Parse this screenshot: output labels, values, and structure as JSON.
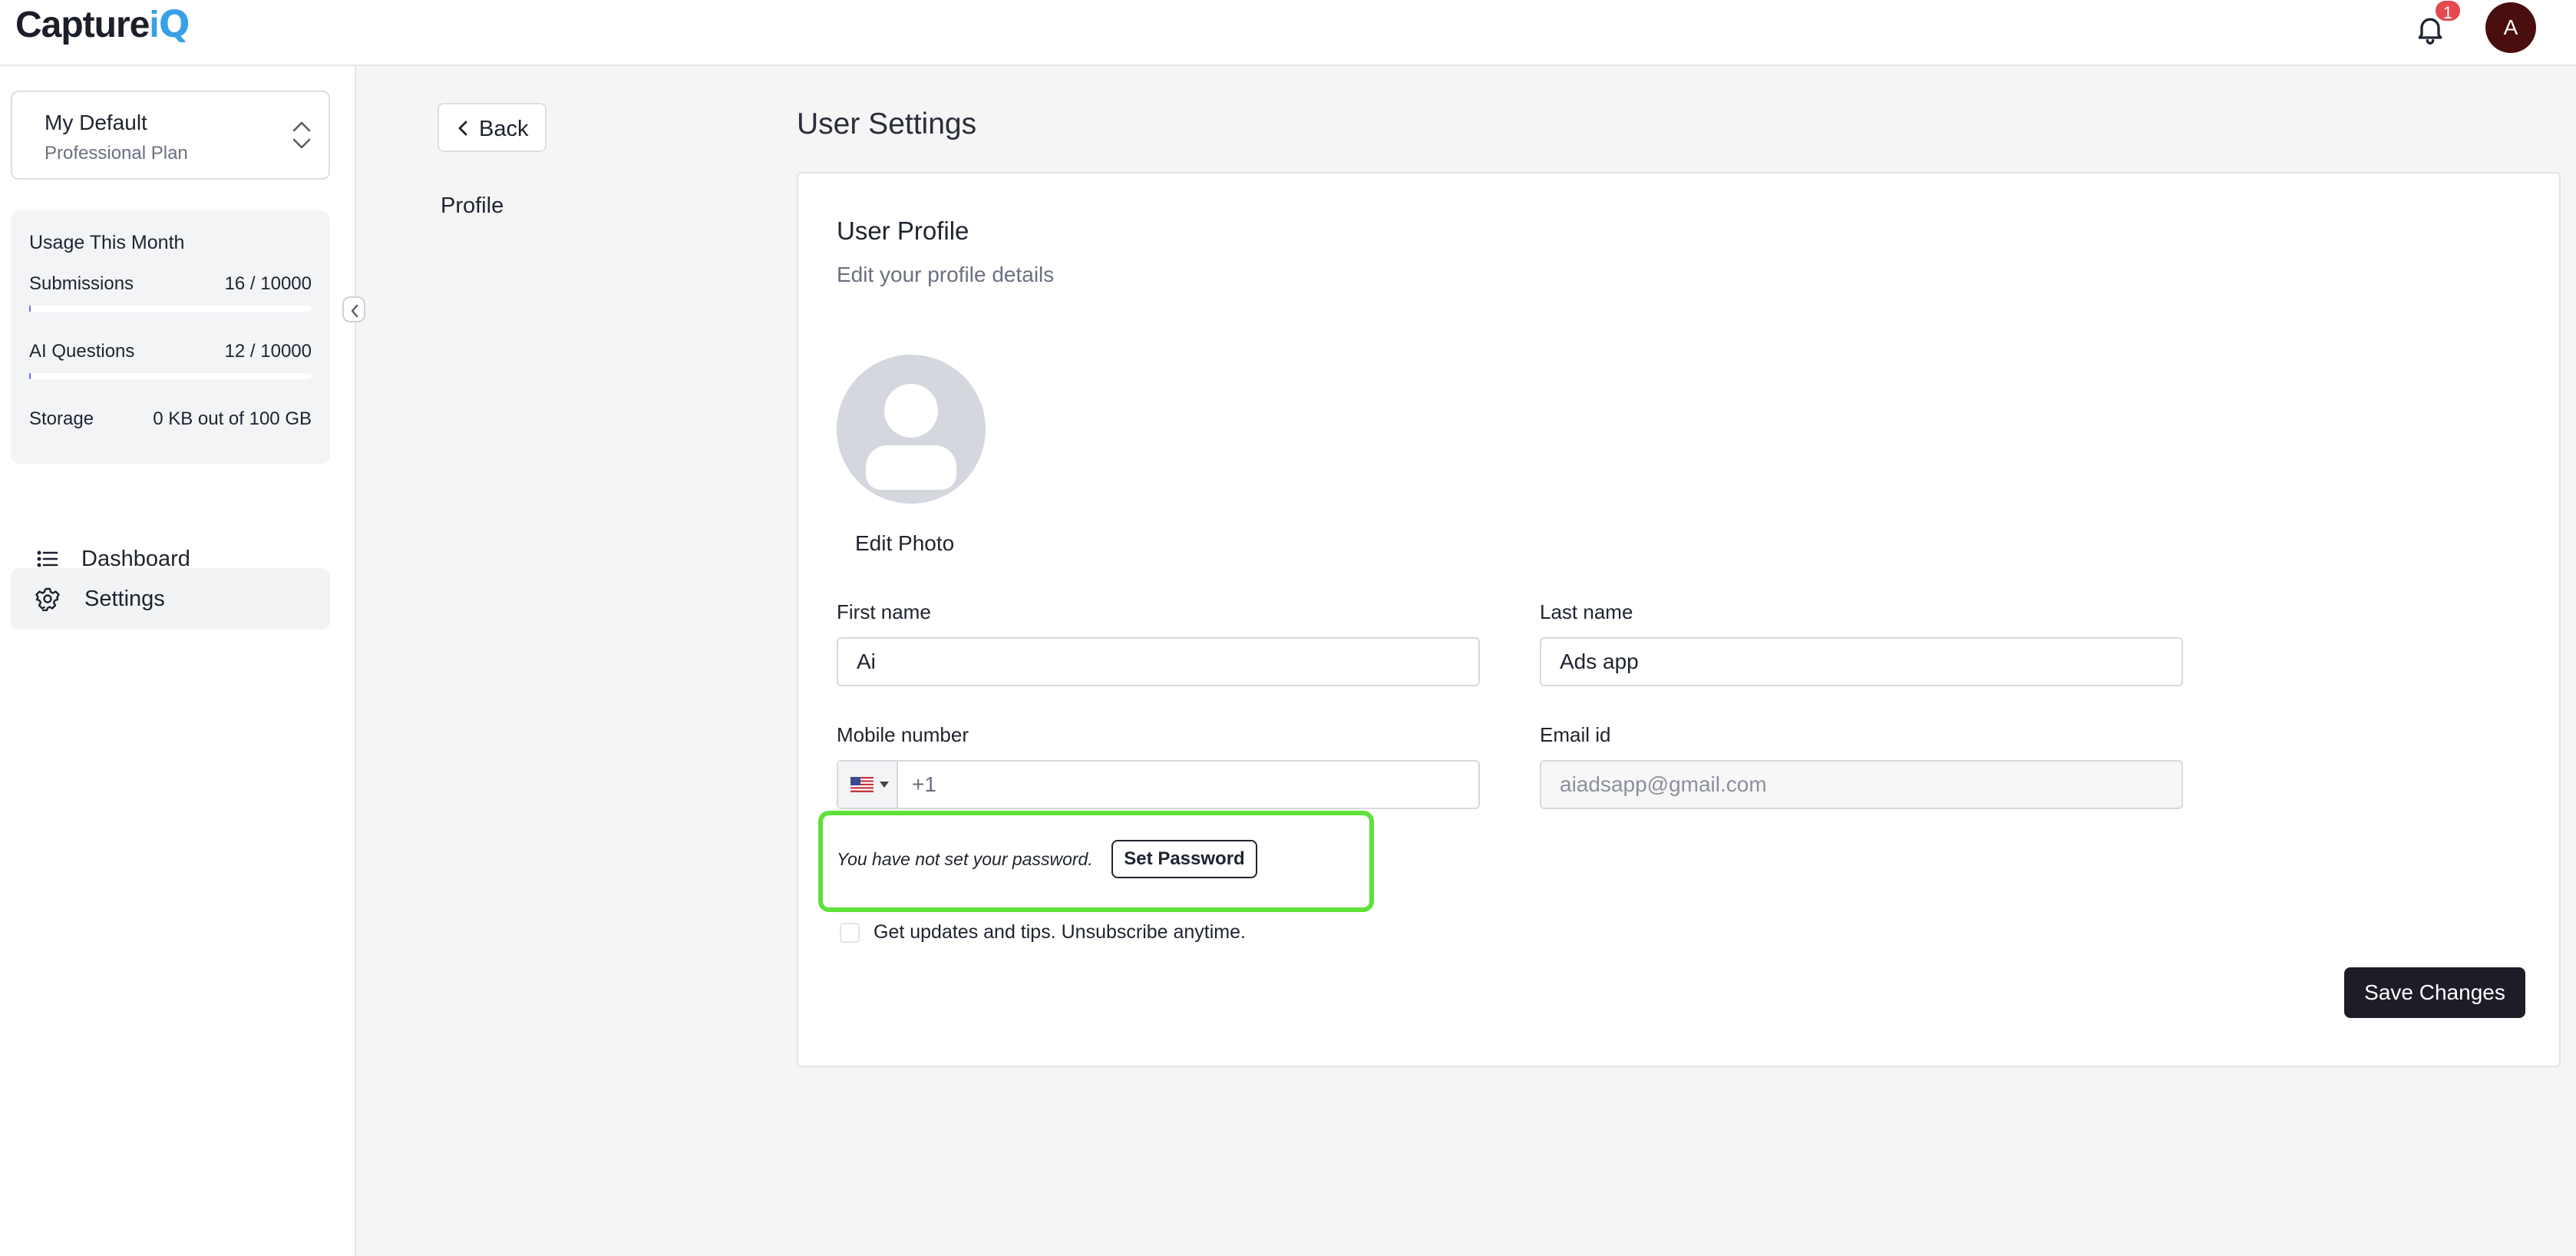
{
  "header": {
    "logo": {
      "part1": "Capture",
      "part2": "i",
      "part3": "Q"
    },
    "notifications_count": "1",
    "avatar_initial": "A"
  },
  "sidebar": {
    "workspace": {
      "name": "My Default",
      "plan": "Professional Plan"
    },
    "usage": {
      "title": "Usage This Month",
      "rows": [
        {
          "label": "Submissions",
          "value": "16 / 10000",
          "fraction": 0.0016
        },
        {
          "label": "AI Questions",
          "value": "12 / 10000",
          "fraction": 0.0012
        },
        {
          "label": "Storage",
          "value": "0 KB out of 100 GB"
        }
      ]
    },
    "nav": [
      {
        "label": "Dashboard",
        "icon": "list-icon",
        "active": false
      },
      {
        "label": "Settings",
        "icon": "gear-icon",
        "active": true
      }
    ]
  },
  "main": {
    "back_label": "Back",
    "profile_nav": "Profile",
    "page_title": "User Settings",
    "card": {
      "title": "User Profile",
      "subtitle": "Edit your profile details",
      "edit_photo": "Edit Photo",
      "first_name": {
        "label": "First name",
        "value": "Ai"
      },
      "last_name": {
        "label": "Last name",
        "value": "Ads app"
      },
      "mobile": {
        "label": "Mobile number",
        "value": "+1"
      },
      "email": {
        "label": "Email id",
        "value": "aiadsapp@gmail.com"
      },
      "password_notice": "You have not set your password.",
      "set_password": "Set Password",
      "updates_label": "Get updates and tips. Unsubscribe anytime.",
      "save": "Save Changes"
    }
  },
  "colors": {
    "accent": "#3aa0e6",
    "badge": "#e5484d",
    "highlight": "#5ee13a",
    "primary_button": "#1c1d26",
    "avatar": "#4a0e0e"
  }
}
